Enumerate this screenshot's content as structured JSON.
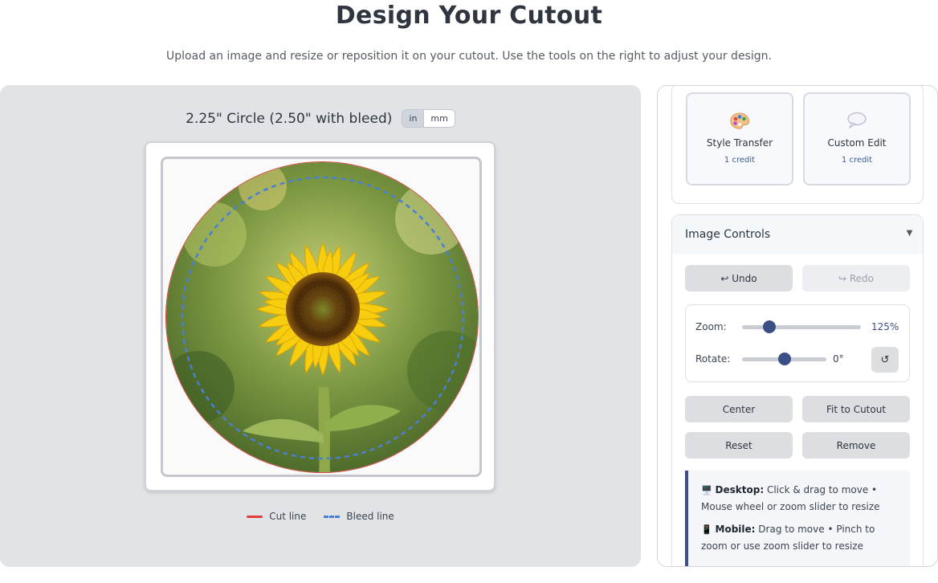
{
  "header": {
    "title": "Design Your Cutout",
    "subtitle": "Upload an image and resize or reposition it on your cutout. Use the tools on the right to adjust your design."
  },
  "canvas": {
    "size_label": "2.25\" Circle (2.50\" with bleed)",
    "units": {
      "in": "in",
      "mm": "mm",
      "selected": "in"
    },
    "image_subject": "sunflower",
    "legend": {
      "cut": "Cut line",
      "bleed": "Bleed line"
    },
    "colors": {
      "cut_line": "#e0403c",
      "bleed_line": "#4a7fd4"
    }
  },
  "ai_tools": [
    {
      "name": "Style Transfer",
      "credit": "1 credit",
      "icon": "palette-icon"
    },
    {
      "name": "Custom Edit",
      "credit": "1 credit",
      "icon": "speech-bubble-icon"
    }
  ],
  "controls": {
    "title": "Image Controls",
    "undo": "↩ Undo",
    "redo": "↪ Redo",
    "zoom": {
      "label": "Zoom:",
      "value": "125%",
      "fraction": 0.23
    },
    "rotate": {
      "label": "Rotate:",
      "value": "0°",
      "fraction": 0.5
    },
    "center": "Center",
    "fit": "Fit to Cutout",
    "reset": "Reset",
    "remove": "Remove",
    "accent_color": "#3b4e86"
  },
  "tips": {
    "desktop": {
      "icon": "🖥️",
      "label": "Desktop:",
      "text": " Click & drag to move • Mouse wheel or zoom slider to resize"
    },
    "mobile": {
      "icon": "📱",
      "label": "Mobile:",
      "text": " Drag to move • Pinch to zoom or use zoom slider to resize"
    }
  }
}
